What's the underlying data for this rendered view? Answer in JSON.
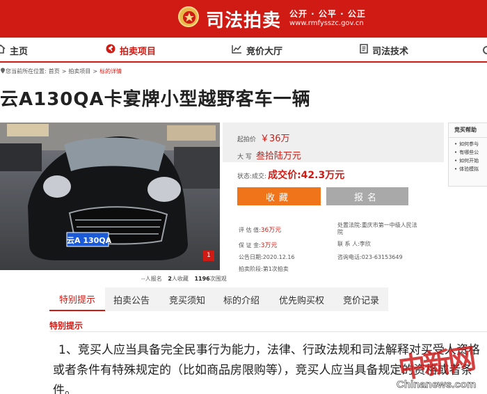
{
  "banner": {
    "site_name": "司法拍卖",
    "slogan": "公开 · 公平 · 公正",
    "domain": "www.rmfysszc.gov.cn",
    "brand_color": "#cf1b14"
  },
  "nav": {
    "items": [
      {
        "label": "主页",
        "icon": "home-icon"
      },
      {
        "label": "拍卖项目",
        "icon": "gavel-icon",
        "active": true
      },
      {
        "label": "竞价大厅",
        "icon": "chart-icon"
      },
      {
        "label": "司法技术",
        "icon": "document-icon"
      }
    ]
  },
  "breadcrumb": {
    "prefix": "您当前所在位置:",
    "items": [
      "首页",
      "拍卖项目",
      "标的详情"
    ],
    "separator": ">"
  },
  "lot": {
    "title": "云A130QA卡宴牌小型越野客车一辆",
    "plate_text": "云A 130QA",
    "photo_index": "1"
  },
  "stats": {
    "registered_prefix": "--人报名",
    "favorites_count": "2",
    "favorites_label": "人收藏",
    "views_count": "1196",
    "views_label": "次围观"
  },
  "price": {
    "start_label": "起拍价",
    "start_value": "￥36万",
    "caps_label": "大  写",
    "caps_value": "叁拾陆万元",
    "status_label": "状态:成交:",
    "status_value": "成交价:42.3万元"
  },
  "buttons": {
    "favorite": "收藏",
    "register": "报名"
  },
  "details": {
    "assess_label": "评 估 值:",
    "assess_value": "36万元",
    "deposit_label": "保 证 金:",
    "deposit_value": "3万元",
    "announce_label": "公告日期:",
    "announce_value": "2020.12.16",
    "stage_label": "拍卖阶段:",
    "stage_value": "第1次拍卖",
    "court_label": "处置法院:",
    "court_value_1": "重庆市第一中级人民法",
    "court_value_2": "院",
    "contact_label": "联 系 人:",
    "contact_value": "李欣",
    "phone_label": "咨询电话:",
    "phone_value": "023-63153649"
  },
  "help": {
    "title": "竞买帮助",
    "items": [
      "如何参与",
      "有哪些公",
      "如何开始",
      "体验模拟"
    ]
  },
  "tabs": [
    "特别提示",
    "拍卖公告",
    "竞买须知",
    "标的介绍",
    "优先购买权",
    "竞价记录"
  ],
  "section": {
    "heading": "特别提示",
    "text": "1、竞买人应当具备完全民事行为能力，法律、行政法规和司法解释对买受人资格或者条件有特殊规定的（比如商品房限购等），竞买人应当具备规定的资格或者条件。"
  },
  "watermark": {
    "cn": "中新网",
    "en": "Chinanews.com"
  }
}
